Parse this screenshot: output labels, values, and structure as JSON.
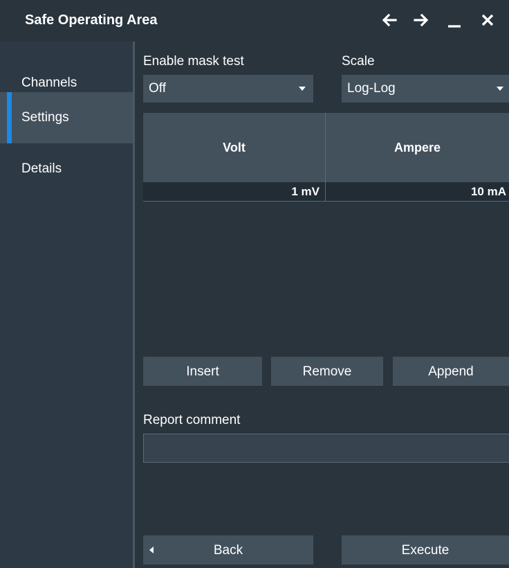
{
  "window": {
    "title": "Safe Operating Area",
    "controls": [
      "arrow-left-icon",
      "arrow-right-icon",
      "minimize-icon",
      "close-icon"
    ]
  },
  "sidebar": {
    "items": [
      {
        "label": "Channels",
        "active": false
      },
      {
        "label": "Settings",
        "active": true
      },
      {
        "label": "Details",
        "active": false
      }
    ]
  },
  "settings": {
    "mask_test": {
      "label": "Enable mask test",
      "value": "Off"
    },
    "scale": {
      "label": "Scale",
      "value": "Log-Log"
    }
  },
  "table": {
    "columns": [
      "Volt",
      "Ampere"
    ],
    "rows": [
      {
        "volt": "1 mV",
        "ampere": "10 mA"
      }
    ]
  },
  "actions": {
    "insert": "Insert",
    "remove": "Remove",
    "append": "Append"
  },
  "report": {
    "label": "Report comment",
    "value": ""
  },
  "footer": {
    "back": "Back",
    "execute": "Execute"
  },
  "colors": {
    "background": "#2a343d",
    "panel": "#43515d",
    "accent": "#1e88e5"
  }
}
